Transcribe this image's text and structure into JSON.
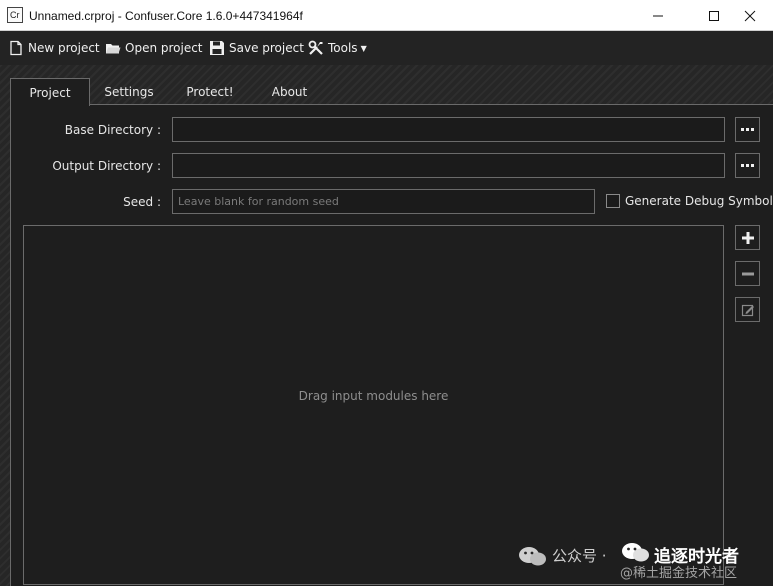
{
  "window": {
    "title": "Unnamed.crproj - Confuser.Core 1.6.0+447341964f",
    "icon_text": "Cr"
  },
  "toolbar": {
    "new_project": "New project",
    "open_project": "Open project",
    "save_project": "Save project",
    "tools": "Tools"
  },
  "tabs": [
    {
      "label": "Project",
      "active": true
    },
    {
      "label": "Settings",
      "active": false
    },
    {
      "label": "Protect!",
      "active": false
    },
    {
      "label": "About",
      "active": false
    }
  ],
  "project": {
    "base_directory_label": "Base Directory :",
    "base_directory_value": "",
    "output_directory_label": "Output Directory :",
    "output_directory_value": "",
    "seed_label": "Seed :",
    "seed_value": "",
    "seed_placeholder": "Leave blank for random seed",
    "debug_symbols_label": "Generate Debug Symbols",
    "debug_symbols_checked": false,
    "drop_hint": "Drag input modules here"
  },
  "watermark": {
    "line1": "公众号 ·",
    "line2": "追逐时光者",
    "line3": "@稀土掘金技术社区"
  },
  "colors": {
    "background": "#262626",
    "panel": "#1e1e1e",
    "border": "#6b6b6b",
    "text": "#e6e6e6",
    "placeholder": "#7a7a7a"
  }
}
